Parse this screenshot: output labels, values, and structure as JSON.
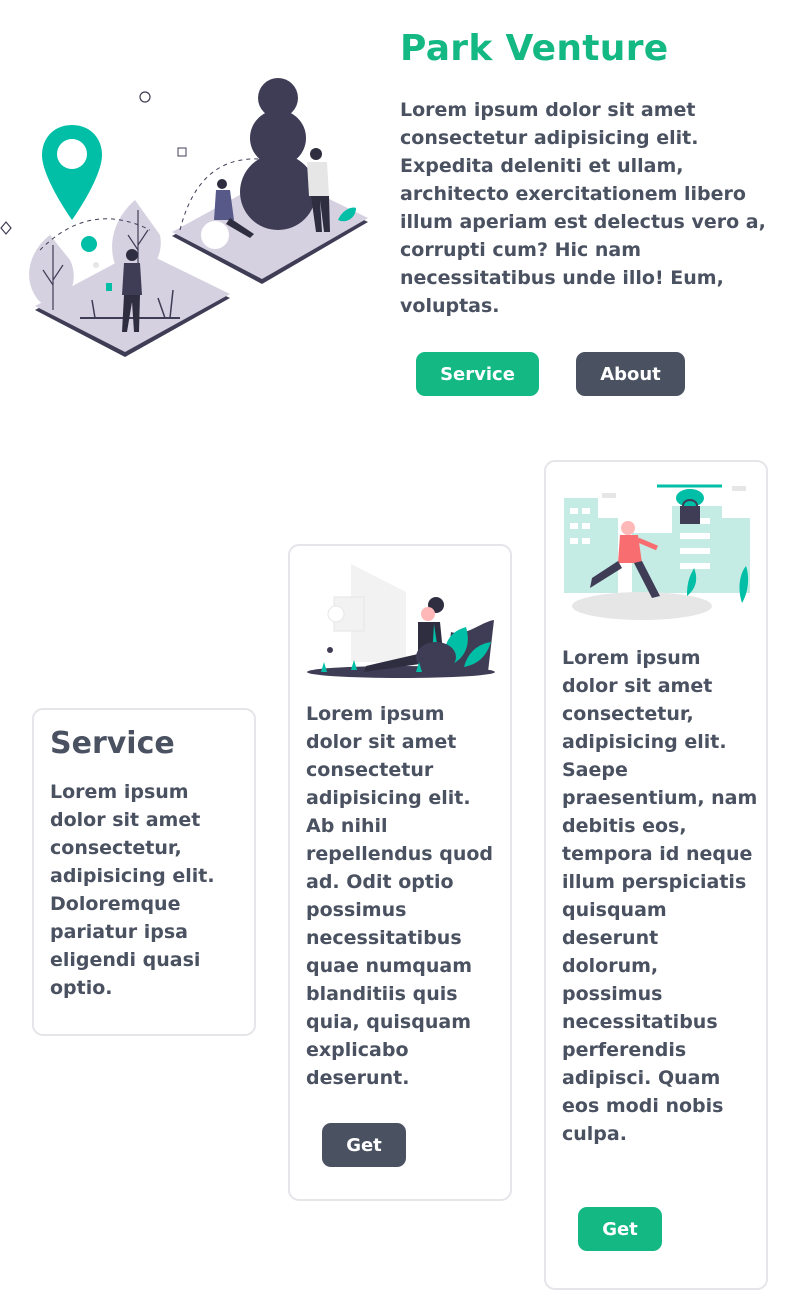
{
  "hero": {
    "title": "Park Venture",
    "description": "Lorem ipsum dolor sit amet consectetur adipisicing elit. Expedita deleniti et ullam, architecto exercitationem libero illum aperiam est delectus vero a, corrupti cum? Hic nam necessitatibus unde illo! Eum, voluptas.",
    "buttons": {
      "service": "Service",
      "about": "About"
    }
  },
  "cards": [
    {
      "title": "Service",
      "text": "Lorem ipsum dolor sit amet consectetur, adipisicing elit. Doloremque pariatur ipsa eligendi quasi optio."
    },
    {
      "text": "Lorem ipsum dolor sit amet consectetur adipisicing elit. Ab nihil repellendus quod ad. Odit optio possimus necessitatibus quae numquam blanditiis quis quia, quisquam explicabo deserunt.",
      "button": "Get"
    },
    {
      "text": "Lorem ipsum dolor sit amet consectetur, adipisicing elit. Saepe praesentium, nam debitis eos, tempora id neque illum perspiciatis quisquam deserunt dolorum, possimus necessitatibus perferendis adipisci. Quam eos modi nobis culpa.",
      "button": "Get"
    }
  ],
  "colors": {
    "accent": "#13b882",
    "dark": "#4a5160",
    "teal": "#00bfa6",
    "illustration_dark": "#3f3d56"
  },
  "icons": [
    "map-pin-icon",
    "park-illustration",
    "relaxing-person-illustration",
    "drone-city-illustration"
  ]
}
